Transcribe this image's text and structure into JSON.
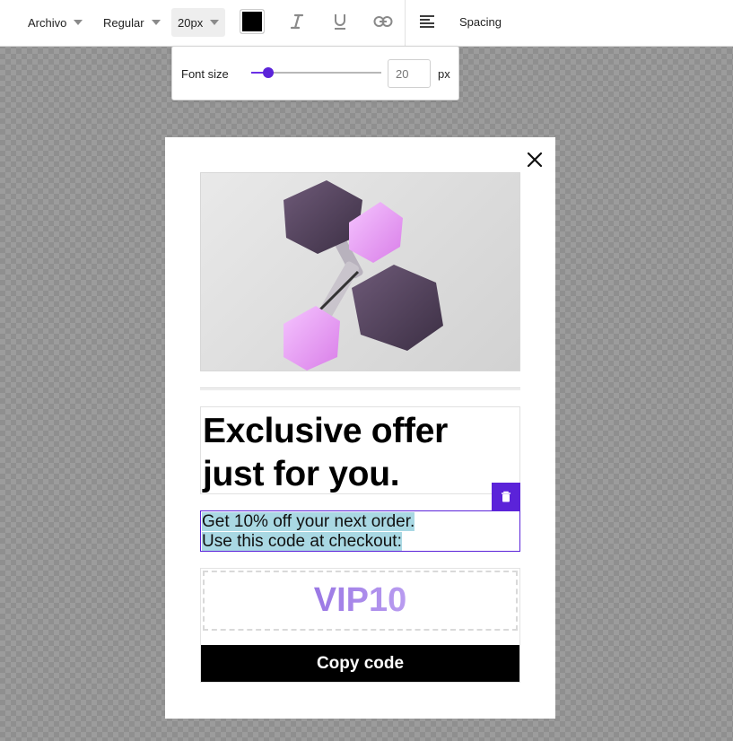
{
  "toolbar": {
    "font_family": "Archivo",
    "font_weight": "Regular",
    "font_size": "20px",
    "text_color": "#000000",
    "italic_icon": "italic-icon",
    "underline_icon": "underline-icon",
    "link_icon": "link-icon",
    "align_icon": "align-left-icon",
    "spacing_label": "Spacing"
  },
  "font_size_popover": {
    "label": "Font size",
    "slider_fraction": 0.13,
    "value": "20",
    "unit": "px"
  },
  "modal": {
    "close_icon": "close-icon",
    "hero_image": "dumbbells-image",
    "headline_line1": "Exclusive offer",
    "headline_line2": "just for you.",
    "delete_icon": "trash-icon",
    "body_line1": "Get 10% off your next order.",
    "body_line2": "Use this code at checkout:",
    "coupon_code": "VIP10",
    "copy_button_label": "Copy code"
  },
  "colors": {
    "accent": "#5b23d9",
    "selection_highlight": "#a9d8e3",
    "coupon_text": "#a98ae8",
    "button_bg": "#000000"
  }
}
